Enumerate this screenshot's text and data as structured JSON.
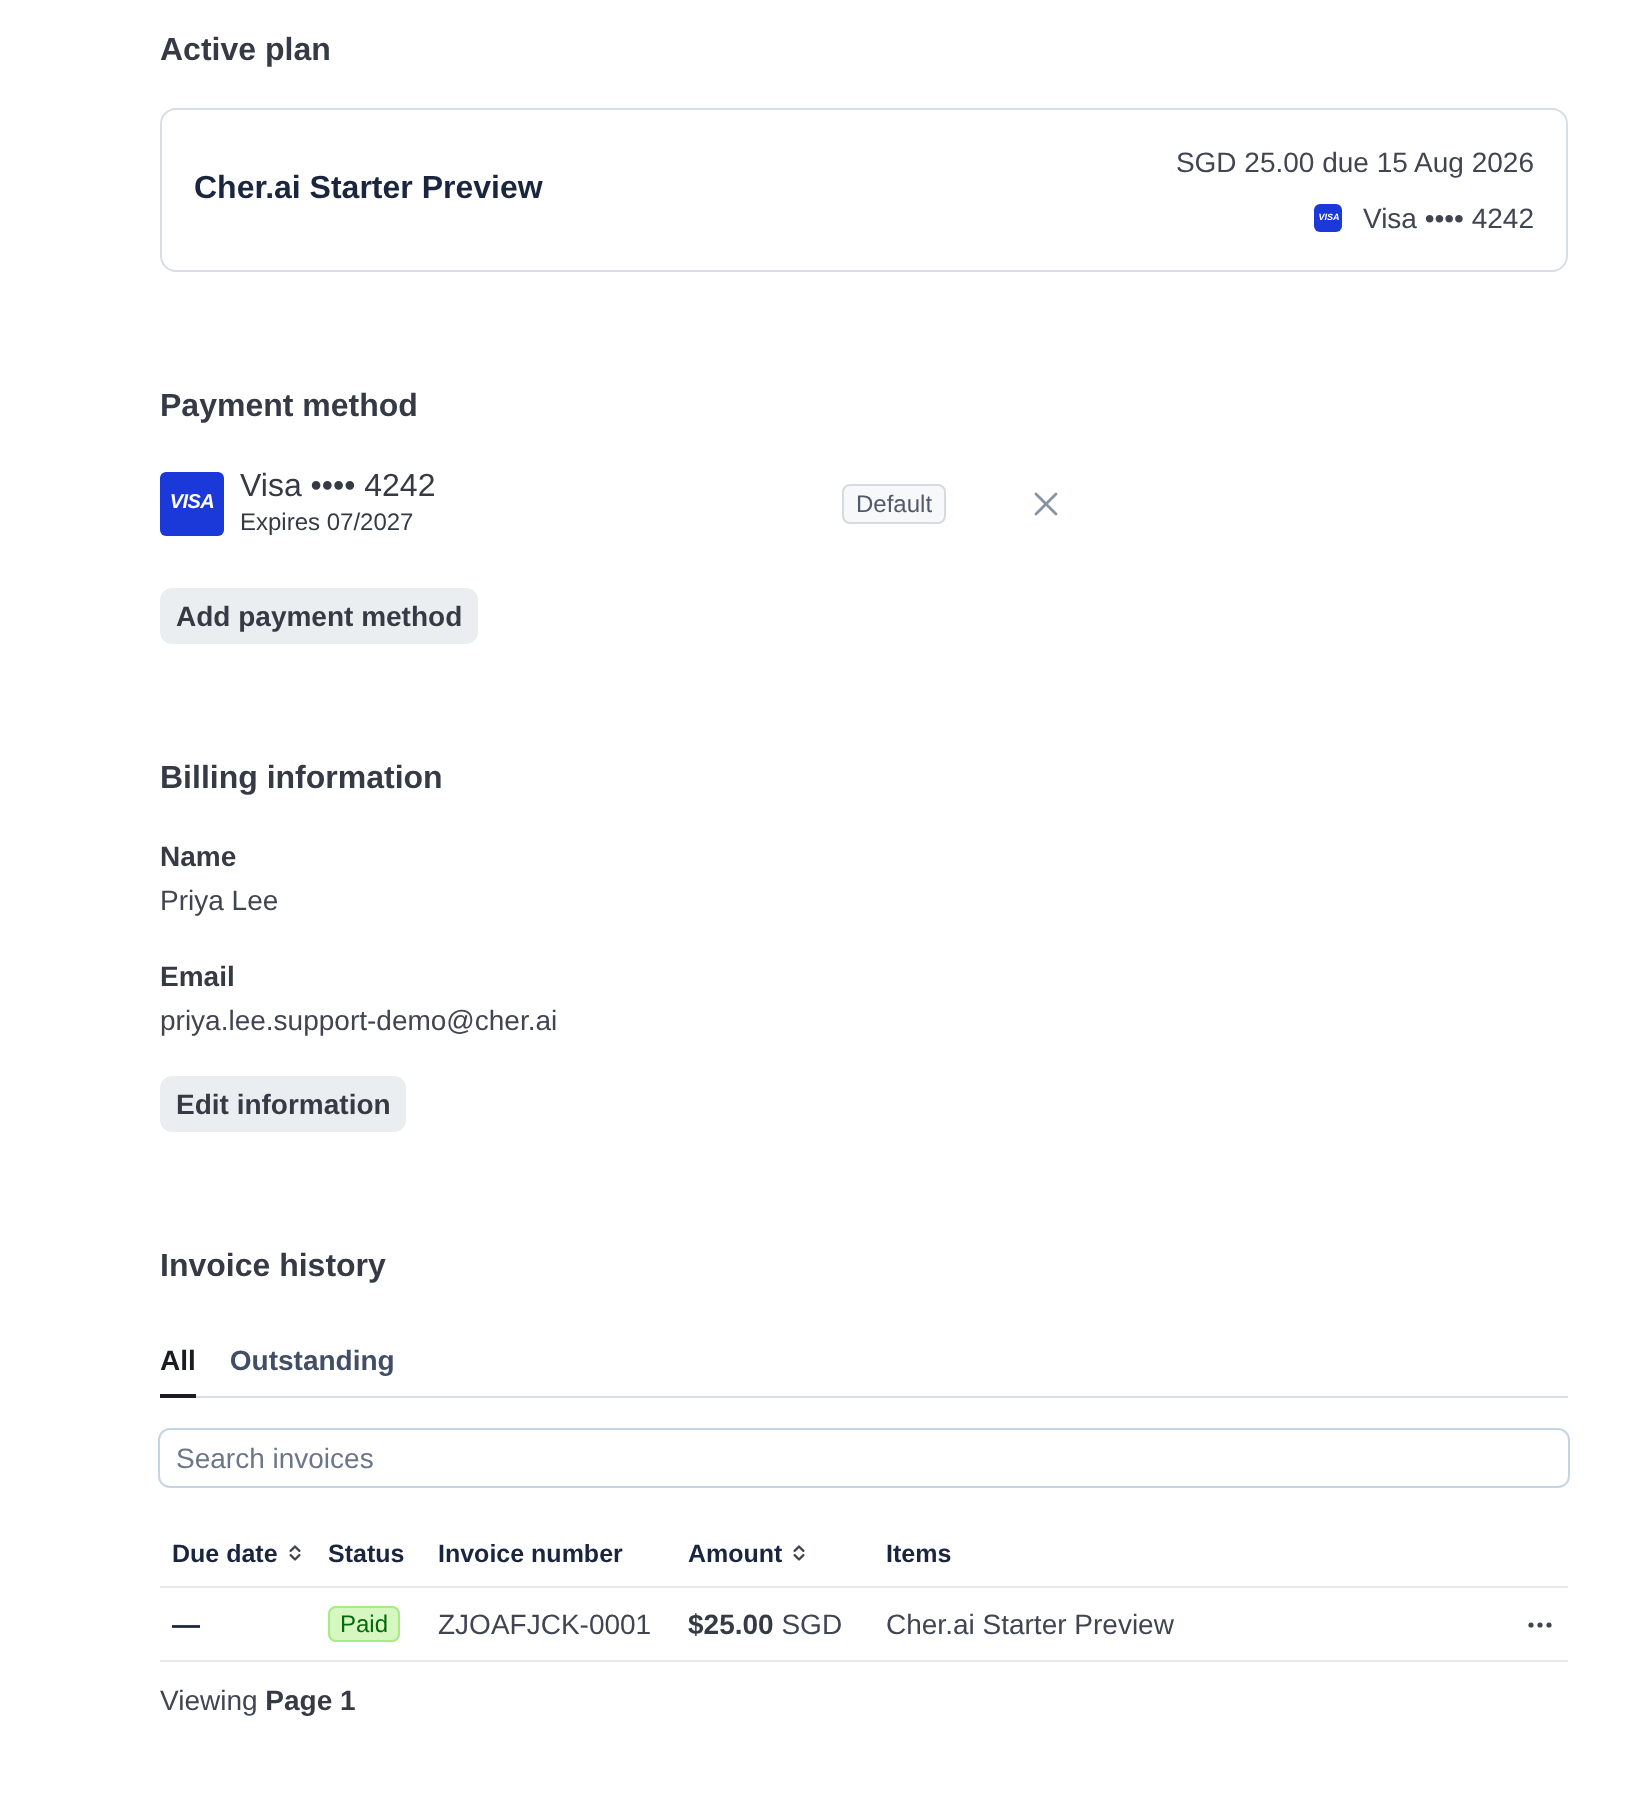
{
  "active_plan": {
    "heading": "Active plan",
    "plan_name": "Cher.ai Starter Preview",
    "due_text": "SGD 25.00 due 15 Aug 2026",
    "card": {
      "logo_text": "VISA",
      "label": "Visa •••• 4242"
    }
  },
  "payment_method": {
    "heading": "Payment method",
    "cards": [
      {
        "logo_text": "VISA",
        "label": "Visa •••• 4242",
        "expires": "Expires 07/2027",
        "badge": "Default"
      }
    ],
    "add_button": "Add payment method"
  },
  "billing_information": {
    "heading": "Billing information",
    "fields": [
      {
        "label": "Name",
        "value": "Priya Lee"
      },
      {
        "label": "Email",
        "value": "priya.lee.support-demo@cher.ai"
      }
    ],
    "edit_button": "Edit information"
  },
  "invoice_history": {
    "heading": "Invoice history",
    "tabs": [
      {
        "label": "All",
        "selected": true
      },
      {
        "label": "Outstanding",
        "selected": false
      }
    ],
    "search": {
      "placeholder": "Search invoices"
    },
    "table": {
      "columns": [
        {
          "label": "Due date",
          "sortable": true
        },
        {
          "label": "Status",
          "sortable": false
        },
        {
          "label": "Invoice number",
          "sortable": false
        },
        {
          "label": "Amount",
          "sortable": true
        },
        {
          "label": "Items",
          "sortable": false
        }
      ],
      "rows": [
        {
          "due_date": "—",
          "status": "Paid",
          "invoice_number": "ZJOAFJCK-0001",
          "amount": "**$25.00** SGD",
          "items": "Cher.ai Starter Preview"
        }
      ]
    },
    "footer": "Viewing **Page 1**"
  }
}
